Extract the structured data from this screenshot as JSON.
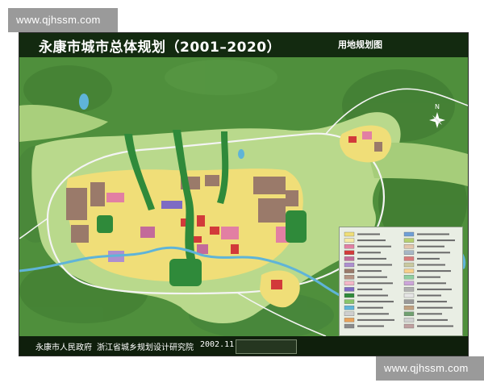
{
  "watermarks": [
    "www.qjhssm.com",
    "www.qjhssm.com"
  ],
  "map": {
    "title": "永康市城市总体规划（2001–2020）",
    "subtitle": "用地规划图",
    "footer": {
      "government": "永康市人民政府",
      "institute": "浙江省城乡规划设计研究院",
      "date": "2002.11"
    }
  },
  "colors": {
    "poster_frame": "#0f1a0c",
    "title_bar": "#132a10",
    "mountain_green": "#4f8f3c",
    "farmland_light_green": "#b9d98c",
    "park_green": "#2f8a3a",
    "residential_yellow": "#f0de78",
    "public_facility_pink": "#e27fa3",
    "commercial_red": "#d23a3a",
    "industrial_brown": "#9a7a6a",
    "water_blue": "#5fb4d8",
    "road_white": "#f4f4f4"
  },
  "legend": {
    "rows": 16,
    "swatch_colors": [
      "#f0de78",
      "#f6e9a6",
      "#e27fa3",
      "#d23a3a",
      "#c36a9a",
      "#ad8fcf",
      "#9a7a6a",
      "#b59484",
      "#f3b6c7",
      "#7e6bc4",
      "#2f8a3a",
      "#87c46a",
      "#5fb4d8",
      "#cfcfcf",
      "#e7a25a",
      "#8a8a8a",
      "#6f9fd6",
      "#b6d06f",
      "#e3c6ad",
      "#a7b6c4",
      "#d97b7b",
      "#c9c9a0",
      "#f7cf8a",
      "#8fcf9f",
      "#cca4d9",
      "#b0b0b0",
      "#e6e6e6",
      "#999",
      "#c0a080",
      "#70a070",
      "#d0d0d0",
      "#bfa0a0"
    ]
  },
  "north_arrow": {
    "icon": "north-arrow-icon"
  }
}
